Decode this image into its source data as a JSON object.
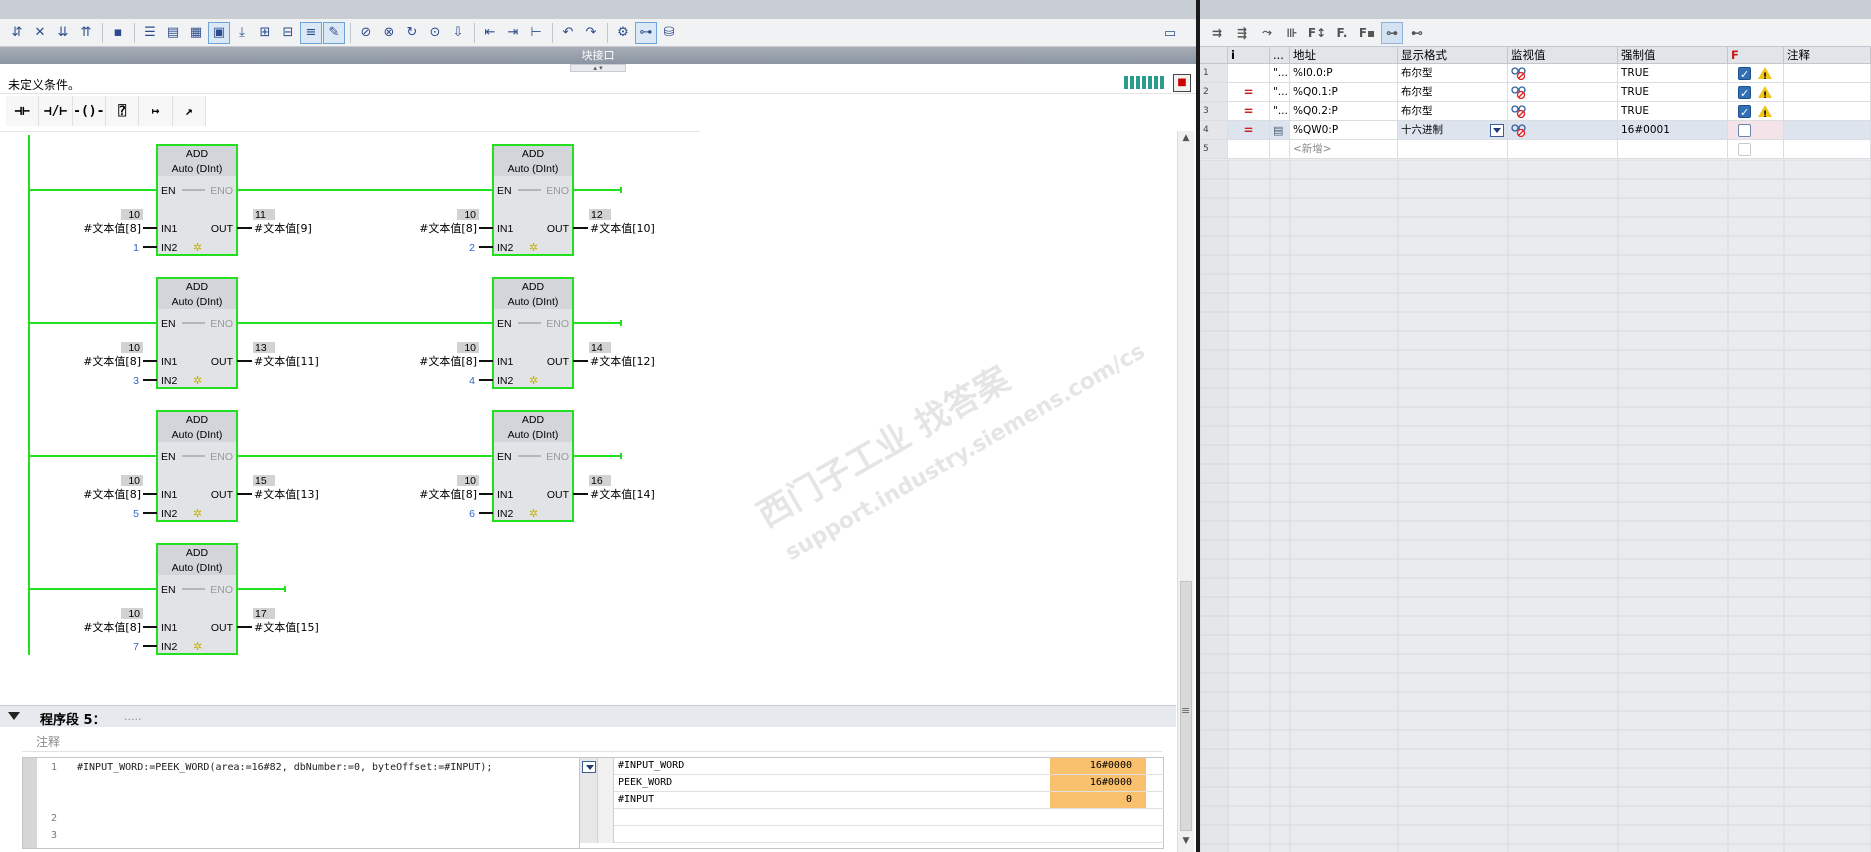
{
  "left_toolbar": {
    "icons": [
      "network-insert-icon",
      "network-delete-icon",
      "network-open-icon",
      "network-close-icon",
      "hide-icon",
      "absolute-address-icon",
      "symbol-info-icon",
      "comment-icon",
      "favorites-icon",
      "goto-down-icon",
      "insert-below-icon",
      "insert-above-icon",
      "expand-icon",
      "monitor-toggle-icon",
      "stop-icon",
      "monitor-all-icon",
      "ref-icon",
      "search-icon",
      "nav-icon",
      "list-icon",
      "tree-icon",
      "jump-back-icon",
      "jump-fwd-icon",
      "settings-icon",
      "glasses-icon",
      "db-icon"
    ]
  },
  "block_interface": {
    "label": "块接口"
  },
  "undefined_condition": {
    "text": "未定义条件。"
  },
  "ladder_tools": [
    {
      "name": "no-contact",
      "glyph": "⊣⊢"
    },
    {
      "name": "nc-contact",
      "glyph": "⊣/⊢"
    },
    {
      "name": "coil",
      "glyph": "–( )–"
    },
    {
      "name": "empty-box",
      "glyph": "??"
    },
    {
      "name": "open-branch",
      "glyph": "↦"
    },
    {
      "name": "close-branch",
      "glyph": "↗"
    }
  ],
  "ladder": {
    "boxes": [
      {
        "op": "ADD",
        "type": "Auto (DInt)",
        "in1_val": "10",
        "in1_var": "#文本值[8]",
        "in2_val": "1",
        "out_val": "11",
        "out_var": "#文本值[9]"
      },
      {
        "op": "ADD",
        "type": "Auto (DInt)",
        "in1_val": "10",
        "in1_var": "#文本值[8]",
        "in2_val": "2",
        "out_val": "12",
        "out_var": "#文本值[10]"
      },
      {
        "op": "ADD",
        "type": "Auto (DInt)",
        "in1_val": "10",
        "in1_var": "#文本值[8]",
        "in2_val": "3",
        "out_val": "13",
        "out_var": "#文本值[11]"
      },
      {
        "op": "ADD",
        "type": "Auto (DInt)",
        "in1_val": "10",
        "in1_var": "#文本值[8]",
        "in2_val": "4",
        "out_val": "14",
        "out_var": "#文本值[12]"
      },
      {
        "op": "ADD",
        "type": "Auto (DInt)",
        "in1_val": "10",
        "in1_var": "#文本值[8]",
        "in2_val": "5",
        "out_val": "15",
        "out_var": "#文本值[13]"
      },
      {
        "op": "ADD",
        "type": "Auto (DInt)",
        "in1_val": "10",
        "in1_var": "#文本值[8]",
        "in2_val": "6",
        "out_val": "16",
        "out_var": "#文本值[14]"
      },
      {
        "op": "ADD",
        "type": "Auto (DInt)",
        "in1_val": "10",
        "in1_var": "#文本值[8]",
        "in2_val": "7",
        "out_val": "17",
        "out_var": "#文本值[15]"
      }
    ],
    "pin_labels": {
      "en": "EN",
      "eno": "ENO",
      "in1": "IN1",
      "in2": "IN2",
      "out": "OUT"
    },
    "colors": {
      "active": "#22e01e",
      "box_bg": "#e2e3e6",
      "header_bg": "#d3d5da",
      "value_bg": "#d2d2d2",
      "in2_num": "#2d65c8"
    }
  },
  "watermark": {
    "line1": "西门子工业  找答案",
    "line2": "support.industry.siemens.com/cs"
  },
  "network5": {
    "title": "程序段 5：",
    "dots": ".....",
    "comment_placeholder": "注释",
    "scl_line_numbers": [
      "1",
      "2",
      "3"
    ],
    "scl_code_line1": "#INPUT_WORD:=PEEK_WORD(area:=16#82, dbNumber:=0, byteOffset:=#INPUT);",
    "watch": [
      {
        "name": "#INPUT_WORD",
        "value": "16#0000"
      },
      {
        "name": "PEEK_WORD",
        "value": "16#0000"
      },
      {
        "name": "#INPUT",
        "value": "0"
      }
    ]
  },
  "force_table": {
    "headers": [
      "i",
      "...",
      "地址",
      "显示格式",
      "监视值",
      "强制值",
      "F",
      "注释"
    ],
    "rows": [
      {
        "num": "1",
        "eq": "",
        "dots": "\"...",
        "addr": "%I0.0:P",
        "fmt": "布尔型",
        "force": "TRUE",
        "checked": true,
        "warn": true
      },
      {
        "num": "2",
        "eq": "=",
        "dots": "\"...",
        "addr": "%Q0.1:P",
        "fmt": "布尔型",
        "force": "TRUE",
        "checked": true,
        "warn": true
      },
      {
        "num": "3",
        "eq": "=",
        "dots": "\"...",
        "addr": "%Q0.2:P",
        "fmt": "布尔型",
        "force": "TRUE",
        "checked": true,
        "warn": true
      },
      {
        "num": "4",
        "eq": "=",
        "dots": "",
        "addr": "%QW0:P",
        "fmt": "十六进制",
        "force": "16#0001",
        "checked": false,
        "warn": false
      },
      {
        "num": "5",
        "eq": "",
        "dots": "",
        "addr": "<新增>",
        "fmt": "",
        "force": "",
        "checked": false,
        "warn": false
      }
    ],
    "colors": {
      "selected_row": "#dde4ee",
      "f_col_tint": "#f4e4ea",
      "header_f": "#c81818"
    }
  }
}
